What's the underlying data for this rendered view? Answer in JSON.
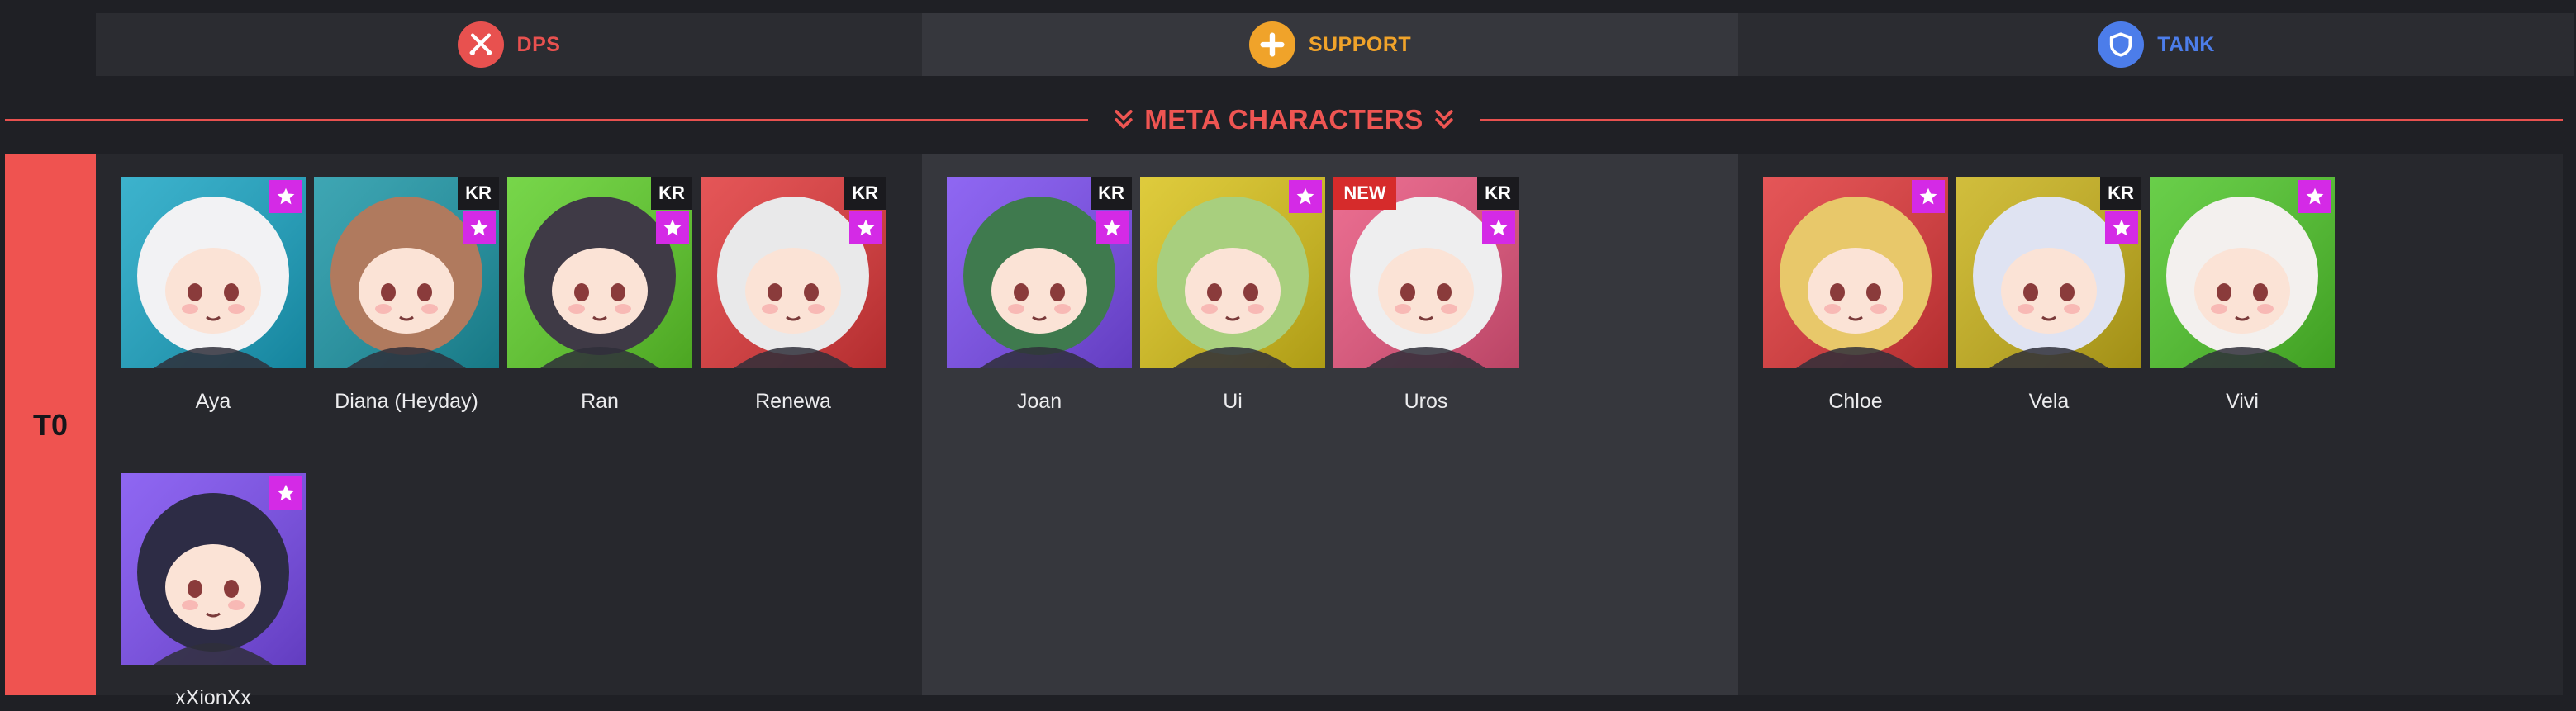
{
  "roles": [
    {
      "key": "dps",
      "label": "DPS",
      "color": "#e8514f",
      "icon": "swords-icon"
    },
    {
      "key": "support",
      "label": "SUPPORT",
      "color": "#f0a32a",
      "icon": "plus-cross-icon"
    },
    {
      "key": "tank",
      "label": "TANK",
      "color": "#4c7dea",
      "icon": "shield-icon"
    }
  ],
  "meta_heading": "META CHARACTERS",
  "tier": {
    "label": "T0"
  },
  "columns": {
    "dps": [
      {
        "name": "Aya",
        "kr": false,
        "new": false,
        "star": true,
        "bg": "#1aa5c4"
      },
      {
        "name": "Diana (Heyday)",
        "kr": true,
        "new": false,
        "star": true,
        "bg": "#1c96a6"
      },
      {
        "name": "Ran",
        "kr": true,
        "new": false,
        "star": true,
        "bg": "#5fcf2a"
      },
      {
        "name": "Renewa",
        "kr": true,
        "new": false,
        "star": true,
        "bg": "#e0383a"
      },
      {
        "name": "xXionXx",
        "kr": false,
        "new": false,
        "star": true,
        "bg": "#7b4cf0"
      }
    ],
    "support": [
      {
        "name": "Joan",
        "kr": true,
        "new": false,
        "star": true,
        "bg": "#7b4cf0"
      },
      {
        "name": "Ui",
        "kr": false,
        "new": false,
        "star": true,
        "bg": "#d9c21a"
      },
      {
        "name": "Uros",
        "kr": true,
        "new": true,
        "star": true,
        "bg": "#e8557e"
      }
    ],
    "tank": [
      {
        "name": "Chloe",
        "kr": false,
        "new": false,
        "star": true,
        "bg": "#e0383a"
      },
      {
        "name": "Vela",
        "kr": true,
        "new": false,
        "star": true,
        "bg": "#c9b21a"
      },
      {
        "name": "Vivi",
        "kr": false,
        "new": false,
        "star": true,
        "bg": "#4fc62a"
      }
    ]
  },
  "badge_text": {
    "kr": "KR",
    "new": "NEW"
  }
}
